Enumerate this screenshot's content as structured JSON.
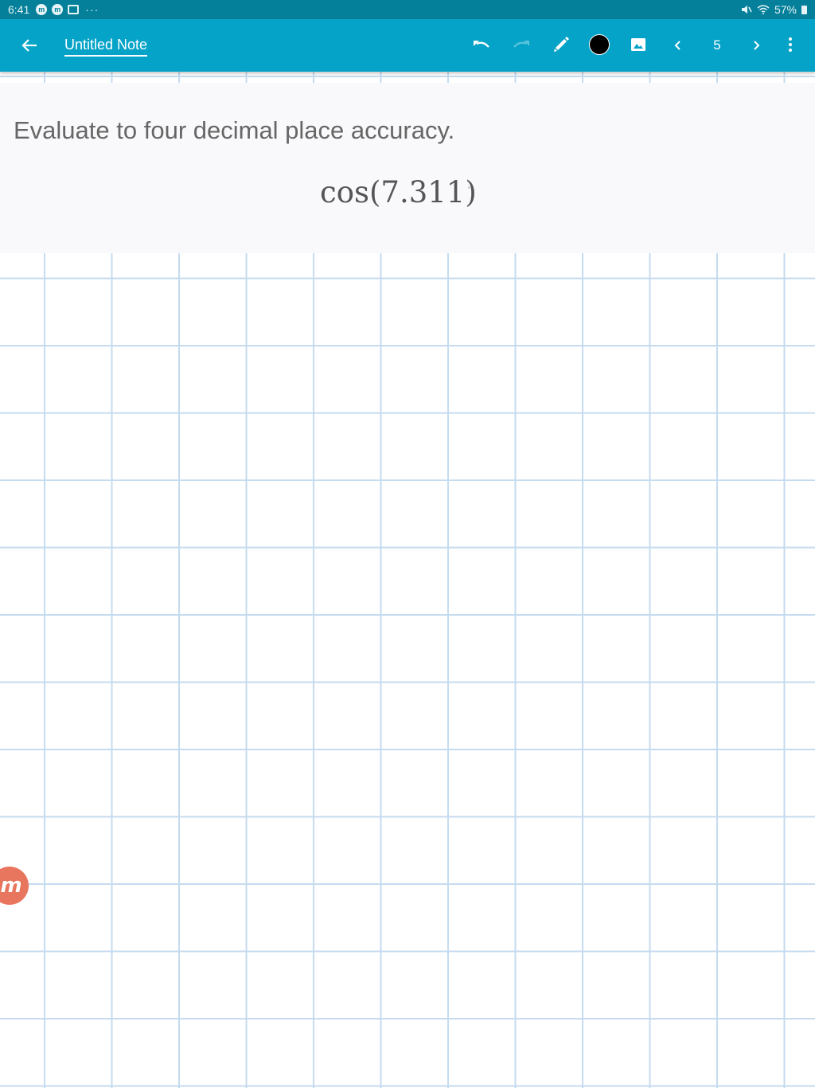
{
  "status_bar": {
    "time": "6:41",
    "left_icons": [
      "messenger-icon",
      "messenger-icon",
      "gallery-icon",
      "more-dots-icon"
    ],
    "left_icon_glyph": "m",
    "dots": "···",
    "battery_percent": "57%",
    "right_icons": [
      "mute-icon",
      "wifi-icon",
      "battery-icon"
    ]
  },
  "app_bar": {
    "background_color": "#04a3c7",
    "back_icon": "arrow-left-icon",
    "title": "Untitled Note",
    "undo_icon": "undo-icon",
    "redo_icon": "redo-icon",
    "redo_enabled": false,
    "pen_icon": "pencil-icon",
    "ink_color": "#000000",
    "image_icon": "image-icon",
    "prev_icon": "chevron-left-icon",
    "page_number": "5",
    "next_icon": "chevron-right-icon",
    "more_icon": "more-vertical-icon"
  },
  "canvas": {
    "grid_color": "#c5dbef"
  },
  "problem": {
    "instruction": "Evaluate to four decimal place accuracy.",
    "expression": "cos(7.311)"
  },
  "watermark": {
    "logo_letter": "m",
    "logo_color": "#e8755d"
  }
}
